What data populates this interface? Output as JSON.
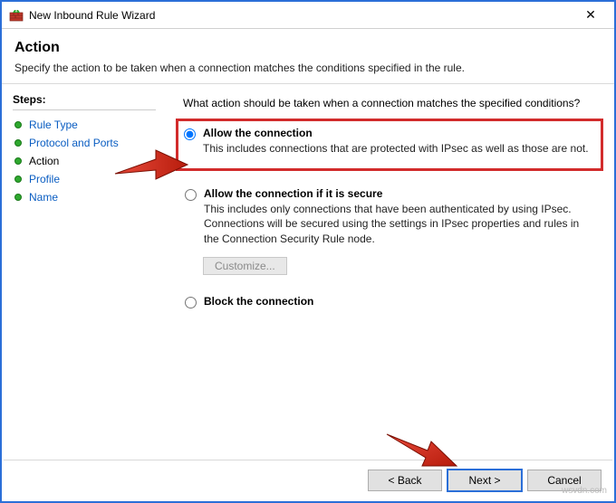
{
  "window": {
    "title": "New Inbound Rule Wizard",
    "close": "✕"
  },
  "header": {
    "title": "Action",
    "subtitle": "Specify the action to be taken when a connection matches the conditions specified in the rule."
  },
  "steps": {
    "header": "Steps:",
    "items": [
      {
        "label": "Rule Type",
        "link": true
      },
      {
        "label": "Protocol and Ports",
        "link": true
      },
      {
        "label": "Action",
        "link": false
      },
      {
        "label": "Profile",
        "link": true
      },
      {
        "label": "Name",
        "link": true
      }
    ]
  },
  "content": {
    "prompt": "What action should be taken when a connection matches the specified conditions?",
    "options": [
      {
        "title": "Allow the connection",
        "desc": "This includes connections that are protected with IPsec as well as those are not.",
        "checked": true
      },
      {
        "title": "Allow the connection if it is secure",
        "desc": "This includes only connections that have been authenticated by using IPsec.  Connections will be secured using the settings in IPsec properties and rules in the Connection Security Rule node.",
        "checked": false,
        "customize": "Customize..."
      },
      {
        "title": "Block the connection",
        "desc": "",
        "checked": false
      }
    ]
  },
  "footer": {
    "back": "< Back",
    "next": "Next >",
    "cancel": "Cancel"
  },
  "watermark": "wsvdn.com"
}
